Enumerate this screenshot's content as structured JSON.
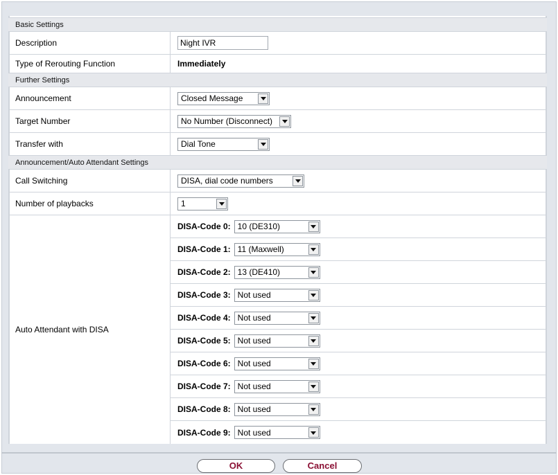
{
  "sections": {
    "basic": "Basic Settings",
    "further": "Further Settings",
    "announcement": "Announcement/Auto Attendant Settings"
  },
  "fields": {
    "description": {
      "label": "Description",
      "value": "Night IVR"
    },
    "rerouting": {
      "label": "Type of Rerouting Function",
      "value": "Immediately"
    },
    "announcement": {
      "label": "Announcement",
      "value": "Closed Message"
    },
    "target_number": {
      "label": "Target Number",
      "value": "No Number (Disconnect)"
    },
    "transfer_with": {
      "label": "Transfer with",
      "value": "Dial Tone"
    },
    "call_switching": {
      "label": "Call Switching",
      "value": "DISA, dial code numbers"
    },
    "playbacks": {
      "label": "Number of playbacks",
      "value": "1"
    },
    "auto_attendant": {
      "label": "Auto Attendant with DISA"
    }
  },
  "disa_codes": [
    {
      "label": "DISA-Code 0:",
      "value": "10 (DE310)"
    },
    {
      "label": "DISA-Code 1:",
      "value": "11 (Maxwell)"
    },
    {
      "label": "DISA-Code 2:",
      "value": "13 (DE410)"
    },
    {
      "label": "DISA-Code 3:",
      "value": "Not used"
    },
    {
      "label": "DISA-Code 4:",
      "value": "Not used"
    },
    {
      "label": "DISA-Code 5:",
      "value": "Not used"
    },
    {
      "label": "DISA-Code 6:",
      "value": "Not used"
    },
    {
      "label": "DISA-Code 7:",
      "value": "Not used"
    },
    {
      "label": "DISA-Code 8:",
      "value": "Not used"
    },
    {
      "label": "DISA-Code 9:",
      "value": "Not used"
    }
  ],
  "buttons": {
    "ok": "OK",
    "cancel": "Cancel"
  }
}
